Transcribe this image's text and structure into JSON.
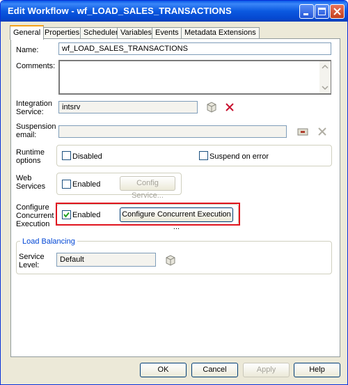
{
  "window": {
    "title": "Edit Workflow - wf_LOAD_SALES_TRANSACTIONS"
  },
  "tabs": [
    "General",
    "Properties",
    "Scheduler",
    "Variables",
    "Events",
    "Metadata Extensions"
  ],
  "form": {
    "name_label": "Name:",
    "name_value": "wf_LOAD_SALES_TRANSACTIONS",
    "comments_label": "Comments:",
    "comments_value": "",
    "integration_label_1": "Integration",
    "integration_label_2": "Service:",
    "integration_value": "intsrv",
    "suspension_label_1": "Suspension",
    "suspension_label_2": "email:",
    "suspension_value": "",
    "runtime_label_1": "Runtime",
    "runtime_label_2": "options",
    "runtime_disabled": "Disabled",
    "runtime_suspend": "Suspend on error",
    "web_label_1": "Web",
    "web_label_2": "Services",
    "web_enabled": "Enabled",
    "web_config_button": "Config Service...",
    "concurrent_label_1": "Configure",
    "concurrent_label_2": "Concurrent",
    "concurrent_label_3": "Execution",
    "concurrent_enabled": "Enabled",
    "concurrent_button": "Configure Concurrent Execution ...",
    "load_balancing_title": "Load Balancing",
    "service_level_label_1": "Service",
    "service_level_label_2": "Level:",
    "service_level_value": "Default"
  },
  "checkbox_state": {
    "runtime_disabled": false,
    "suspend_on_error": false,
    "web_enabled": false,
    "concurrent_enabled": true
  },
  "footer": {
    "ok": "OK",
    "cancel": "Cancel",
    "apply": "Apply",
    "help": "Help"
  },
  "colors": {
    "titlebar": "#0a58e8",
    "highlight_box": "#e0141e",
    "dialog_bg": "#ece9d8",
    "group_title": "#0046d5"
  },
  "icons": [
    "minimize-icon",
    "maximize-icon",
    "close-icon",
    "browse-icon",
    "clear-icon",
    "email-icon",
    "scroll-up-icon",
    "scroll-down-icon"
  ]
}
